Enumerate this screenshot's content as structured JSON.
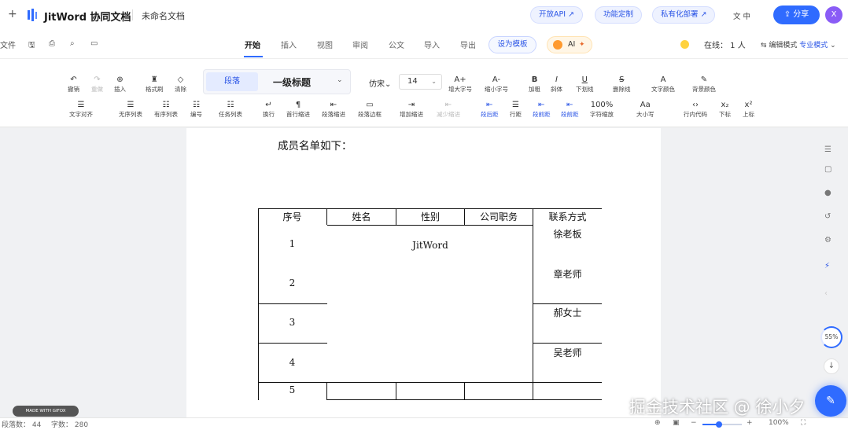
{
  "topbar": {
    "plus": "+",
    "brand": "JitWord 协同文档",
    "doc_name": "未命名文档",
    "open_api": "开放API ↗",
    "custom": "功能定制",
    "private_deploy": "私有化部署 ↗",
    "lang": "文 中",
    "share": "分享",
    "avatar": "X"
  },
  "menu": {
    "file": "文件",
    "tabs": [
      "开始",
      "插入",
      "视图",
      "审阅",
      "公文",
      "导入",
      "导出"
    ],
    "active_tab": "开始",
    "set_template": "设为模板",
    "ai": "AI",
    "online": "在线： 1 人",
    "edit_mode_label": "编辑模式",
    "edit_mode_value": "专业模式"
  },
  "toolbar": {
    "row1": {
      "undo": "撤销",
      "redo": "重做",
      "insert": "插入",
      "format_brush": "格式刷",
      "clear": "清除",
      "style_tag": "段落",
      "heading": "一级标题",
      "font": "仿宋",
      "size": "14",
      "grow": "增大字号",
      "shrink": "缩小字号",
      "bold": "加粗",
      "italic": "斜体",
      "underline": "下划线",
      "strike": "删除线",
      "text_color": "文字颜色",
      "bg_color": "背景颜色"
    },
    "row2": {
      "align": "文字对齐",
      "bullet": "无序列表",
      "ordered": "有序列表",
      "numbering": "编号",
      "task": "任务列表",
      "break": "换行",
      "first_indent": "首行缩进",
      "para_indent": "段落缩进",
      "para_border": "段落边框",
      "add_indent": "增加缩进",
      "reduce_indent": "减少缩进",
      "before_space": "段后距",
      "line_height": "行距",
      "para_spacing": "段前距",
      "after_space": "段前距",
      "char_scale": "字符缩放",
      "scale_value": "100%",
      "font_case": "大小写",
      "inline_code": "行内代码",
      "subscript": "下标",
      "superscript": "上标"
    }
  },
  "document": {
    "intro": "成员名单如下：",
    "table_headers": [
      "序号",
      "姓名",
      "性别",
      "公司职务",
      "联系方式"
    ],
    "row_numbers": [
      "1",
      "2",
      "3",
      "4",
      "5"
    ],
    "merged_text": "JitWord",
    "contacts": [
      "徐老板",
      "章老师",
      "郝女士",
      "吴老师"
    ]
  },
  "status": {
    "paragraphs": "段落数： 44",
    "words": "字数： 280",
    "zoom": "100%",
    "progress_label": "55%",
    "progress": 0.55
  },
  "watermark": "掘金技术社区 @ 徐小夕",
  "gifox_badge": "MADE WITH GIFOX"
}
